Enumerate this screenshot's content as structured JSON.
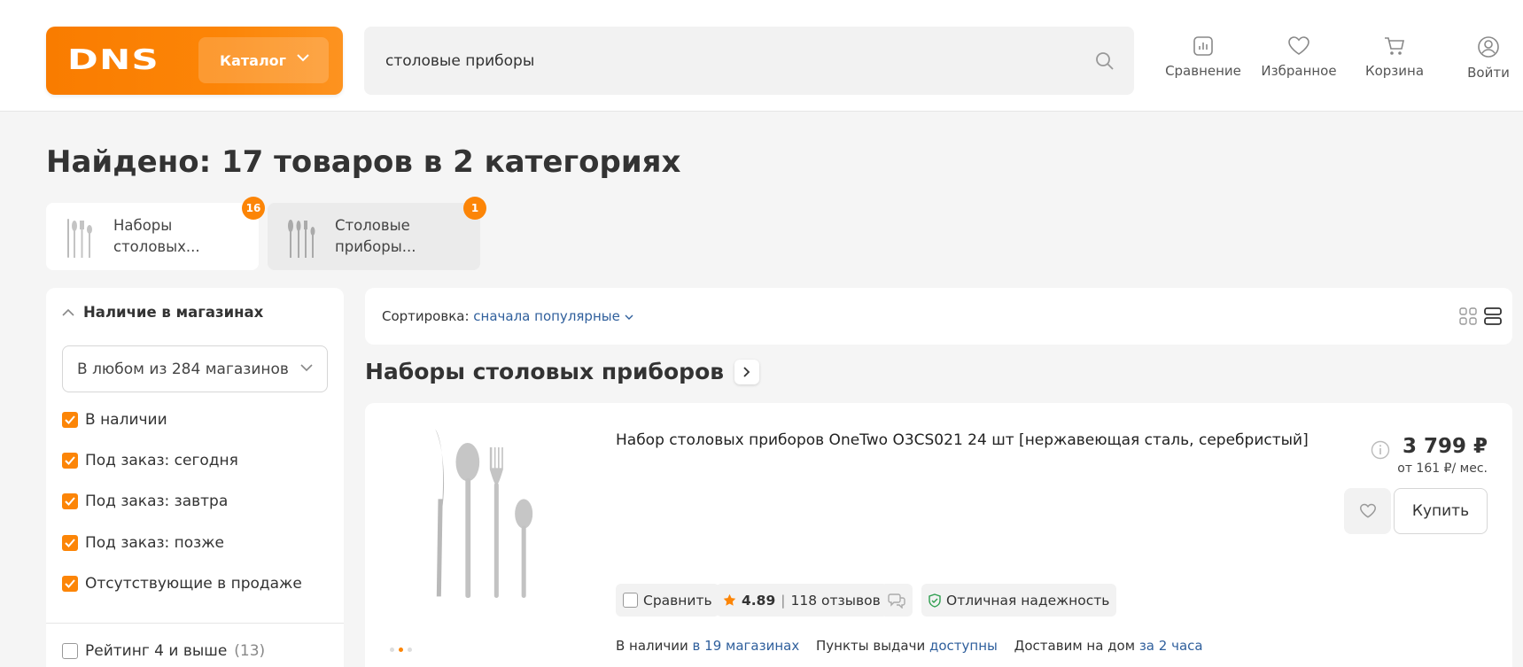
{
  "header": {
    "logo_text": "DNS",
    "catalog_label": "Каталог",
    "search_value": "столовые приборы",
    "nav": [
      {
        "label": "Сравнение",
        "icon": "compare-icon"
      },
      {
        "label": "Избранное",
        "icon": "heart-icon"
      },
      {
        "label": "Корзина",
        "icon": "cart-icon"
      },
      {
        "label": "Войти",
        "icon": "user-icon"
      }
    ]
  },
  "results": {
    "title": "Найдено: 17 товаров в 2 категориях",
    "categories": [
      {
        "label": "Наборы столовых...",
        "count": "16"
      },
      {
        "label": "Столовые приборы...",
        "count": "1"
      }
    ]
  },
  "sidebar": {
    "section_title": "Наличие в магазинах",
    "store_select": "В любом из 284 магазинов",
    "checkboxes": [
      {
        "label": "В наличии",
        "checked": true
      },
      {
        "label": "Под заказ: сегодня",
        "checked": true
      },
      {
        "label": "Под заказ: завтра",
        "checked": true
      },
      {
        "label": "Под заказ: позже",
        "checked": true
      },
      {
        "label": "Отсутствующие в продаже",
        "checked": true
      }
    ],
    "rating_filter": {
      "label": "Рейтинг 4 и выше",
      "count": "(13)"
    }
  },
  "sort": {
    "label": "Сортировка:",
    "value": "сначала популярные"
  },
  "section_title": "Наборы столовых приборов",
  "product": {
    "name": "Набор столовых приборов OneTwo O3CS021 24 шт [нержавеющая сталь, серебристый]",
    "price": "3 799 ₽",
    "credit": "от 161 ₽/ мес.",
    "buy_label": "Купить",
    "compare_label": "Сравнить",
    "rating": "4.89",
    "reviews": "118 отзывов",
    "reliability": "Отличная надежность",
    "availability": {
      "stock_label": "В наличии",
      "stock_link": "в 19 магазинах",
      "pickup_label": "Пункты выдачи",
      "pickup_link": "доступны",
      "delivery_label": "Доставим на дом",
      "delivery_link": "за 2 часа"
    }
  },
  "colors": {
    "accent": "#fc8507",
    "link": "#2f5f9c"
  }
}
